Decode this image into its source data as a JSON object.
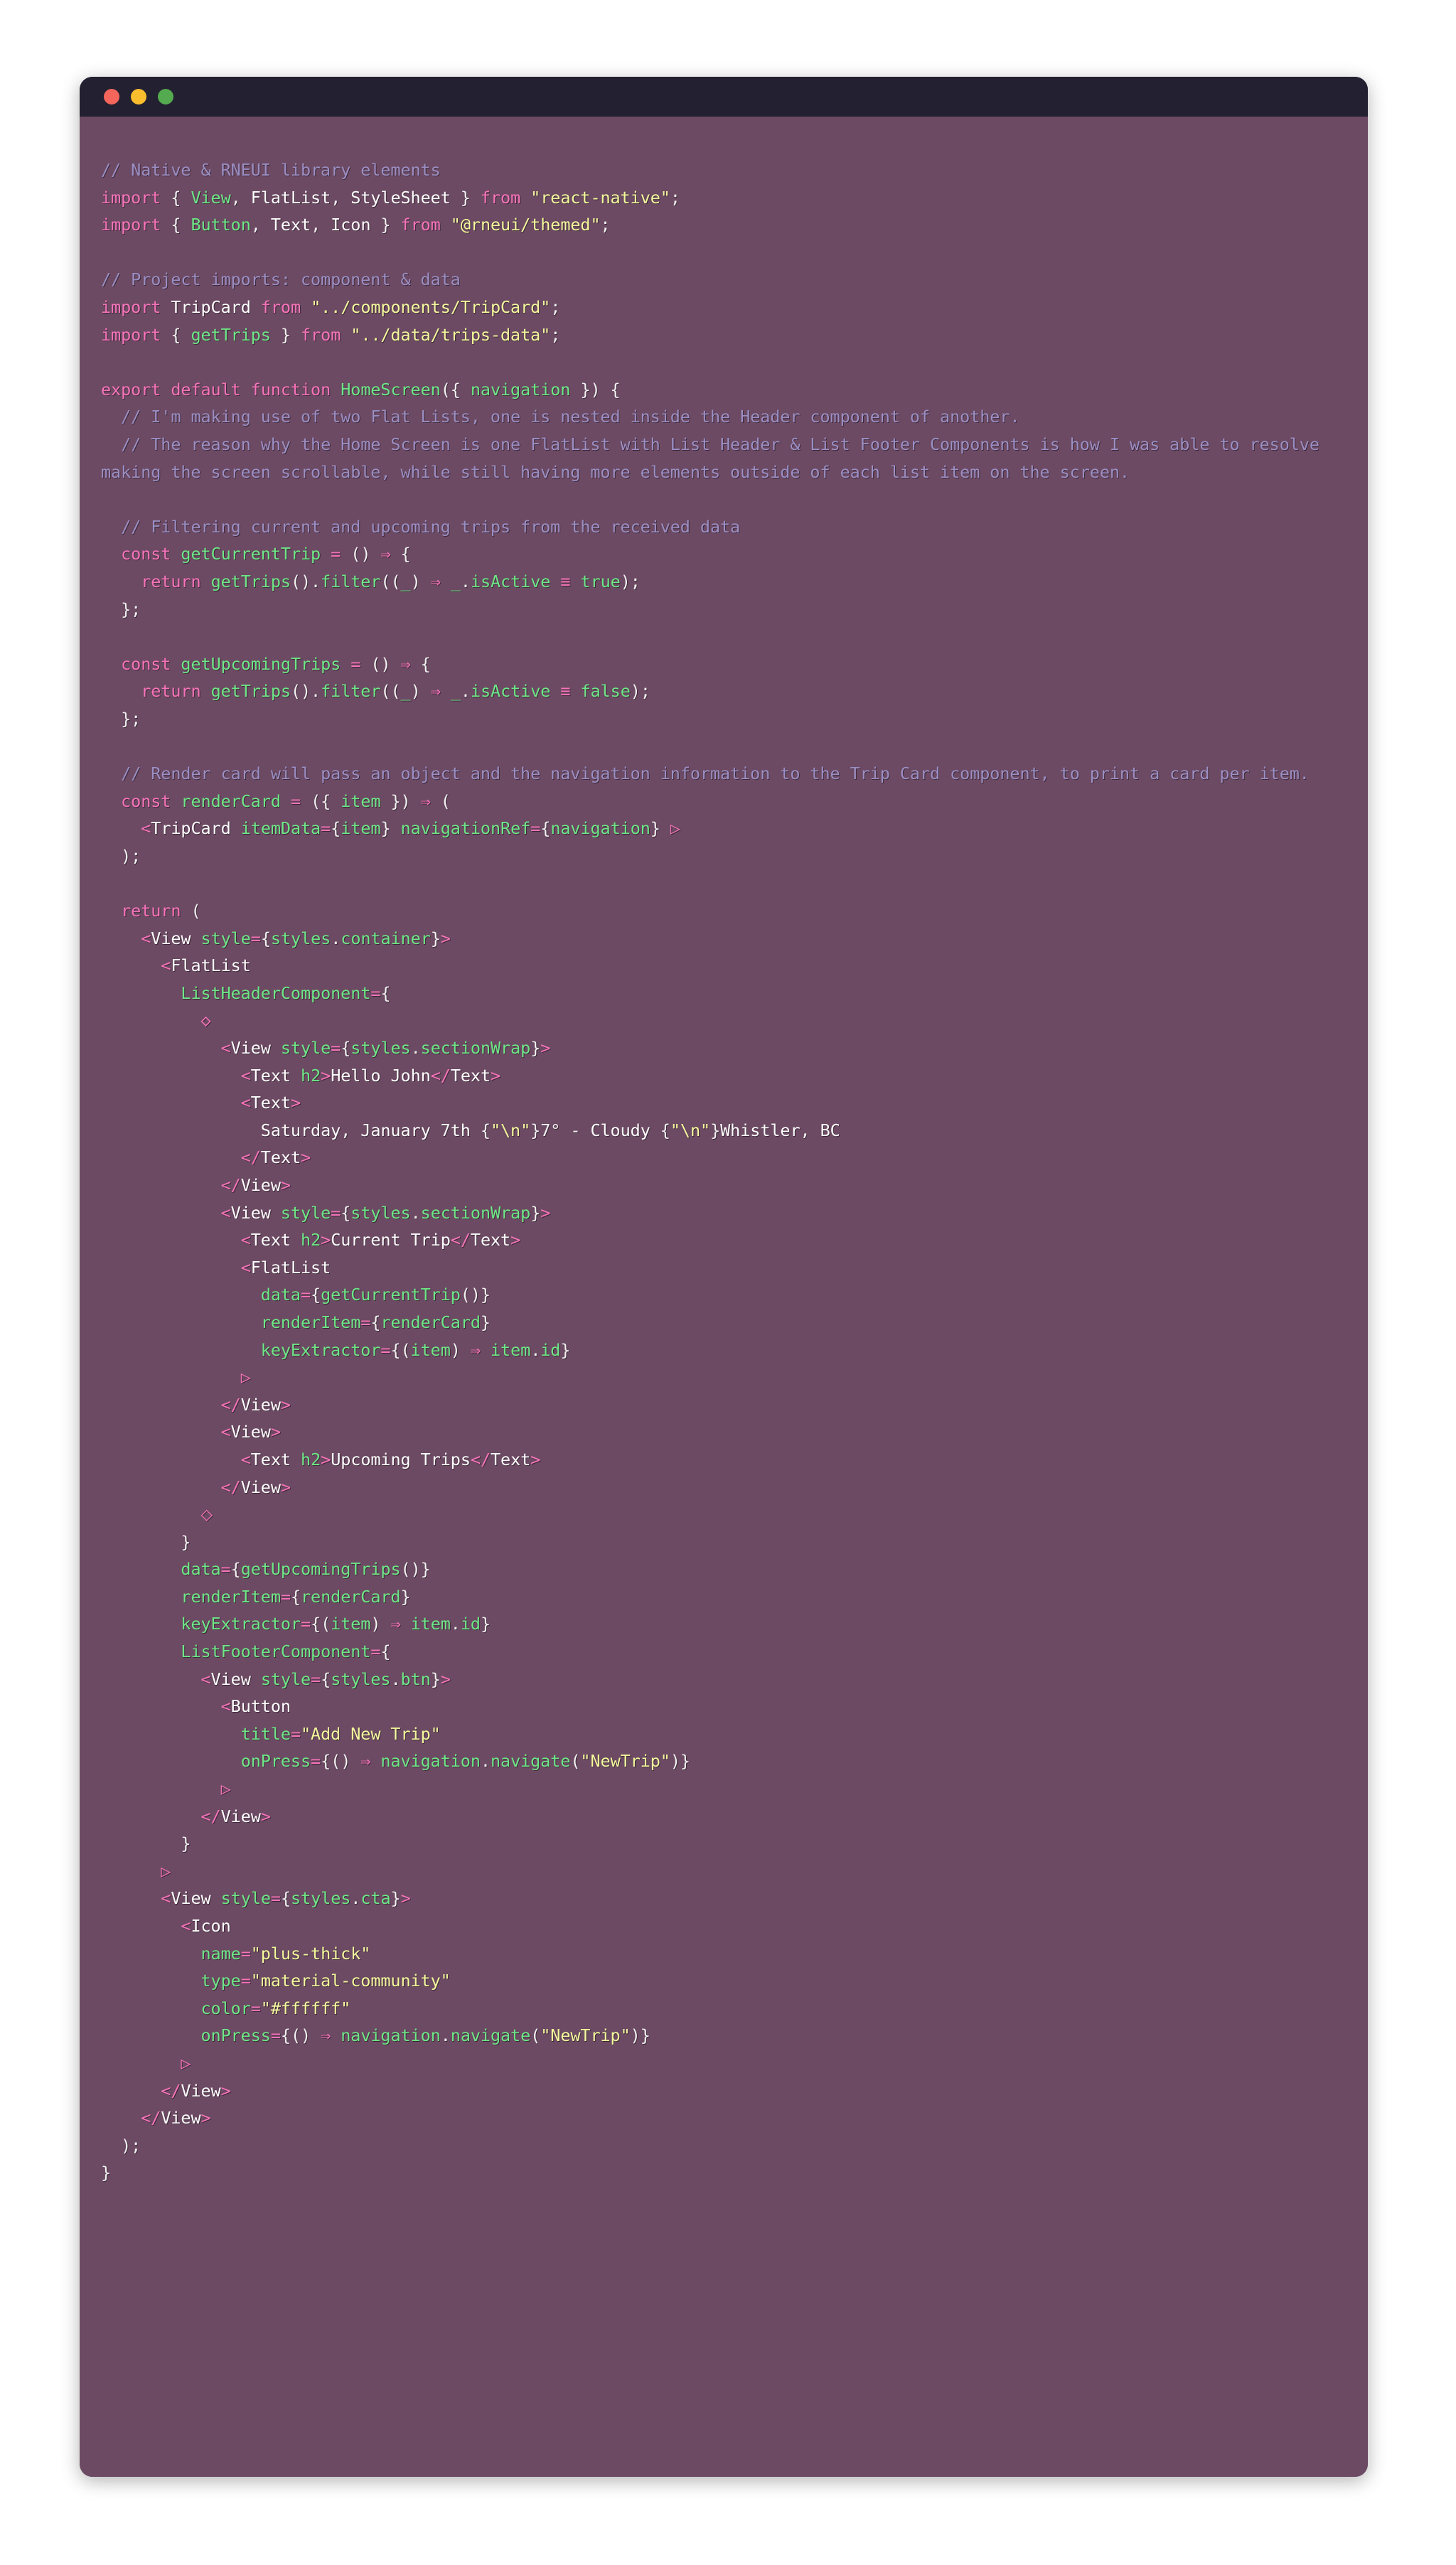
{
  "window": {
    "chrome": {
      "dots": [
        {
          "name": "close-button",
          "color": "#f4655c"
        },
        {
          "name": "minimize-button",
          "color": "#f9bd2e"
        },
        {
          "name": "maximize-button",
          "color": "#54aa4e"
        }
      ]
    },
    "background": "#6d4a63",
    "titlebar_background": "#232031"
  },
  "theme": {
    "comment": "#9b8fc4",
    "keyword": "#f774ba",
    "function": "#6ee787",
    "string": "#f3f99d",
    "plain": "#ffffff",
    "operator": "#f774ba"
  },
  "code": {
    "language": "jsx",
    "lines": [
      "// Native & RNEUI library elements",
      "import { View, FlatList, StyleSheet } from \"react-native\";",
      "import { Button, Text, Icon } from \"@rneui/themed\";",
      "",
      "// Project imports: component & data",
      "import TripCard from \"../components/TripCard\";",
      "import { getTrips } from \"../data/trips-data\";",
      "",
      "export default function HomeScreen({ navigation }) {",
      "  // I'm making use of two Flat Lists, one is nested inside the Header component of another.",
      "  // The reason why the Home Screen is one FlatList with List Header & List Footer Components is how I was able to resolve making the screen scrollable, while still having more elements outside of each list item on the screen.",
      "",
      "  // Filtering current and upcoming trips from the received data",
      "  const getCurrentTrip = () => {",
      "    return getTrips().filter((_) => _.isActive === true);",
      "  };",
      "",
      "  const getUpcomingTrips = () => {",
      "    return getTrips().filter((_) => _.isActive === false);",
      "  };",
      "",
      "  // Render card will pass an object and the navigation information to the Trip Card component, to print a card per item.",
      "  const renderCard = ({ item }) => (",
      "    <TripCard itemData={item} navigationRef={navigation} />",
      "  );",
      "",
      "  return (",
      "    <View style={styles.container}>",
      "      <FlatList",
      "        ListHeaderComponent={",
      "          <>",
      "            <View style={styles.sectionWrap}>",
      "              <Text h2>Hello John</Text>",
      "              <Text>",
      "                Saturday, January 7th {\"\\n\"}7° - Cloudy {\"\\n\"}Whistler, BC",
      "              </Text>",
      "            </View>",
      "            <View style={styles.sectionWrap}>",
      "              <Text h2>Current Trip</Text>",
      "              <FlatList",
      "                data={getCurrentTrip()}",
      "                renderItem={renderCard}",
      "                keyExtractor={(item) => item.id}",
      "              />",
      "            </View>",
      "            <View>",
      "              <Text h2>Upcoming Trips</Text>",
      "            </View>",
      "          </>",
      "        }",
      "        data={getUpcomingTrips()}",
      "        renderItem={renderCard}",
      "        keyExtractor={(item) => item.id}",
      "        ListFooterComponent={",
      "          <View style={styles.btn}>",
      "            <Button",
      "              title=\"Add New Trip\"",
      "              onPress={() => navigation.navigate(\"NewTrip\")}",
      "            />",
      "          </View>",
      "        }",
      "      />",
      "      <View style={styles.cta}>",
      "        <Icon",
      "          name=\"plus-thick\"",
      "          type=\"material-community\"",
      "          color=\"#ffffff\"",
      "          onPress={() => navigation.navigate(\"NewTrip\")}",
      "        />",
      "      </View>",
      "    </View>",
      "  );",
      "}"
    ]
  }
}
